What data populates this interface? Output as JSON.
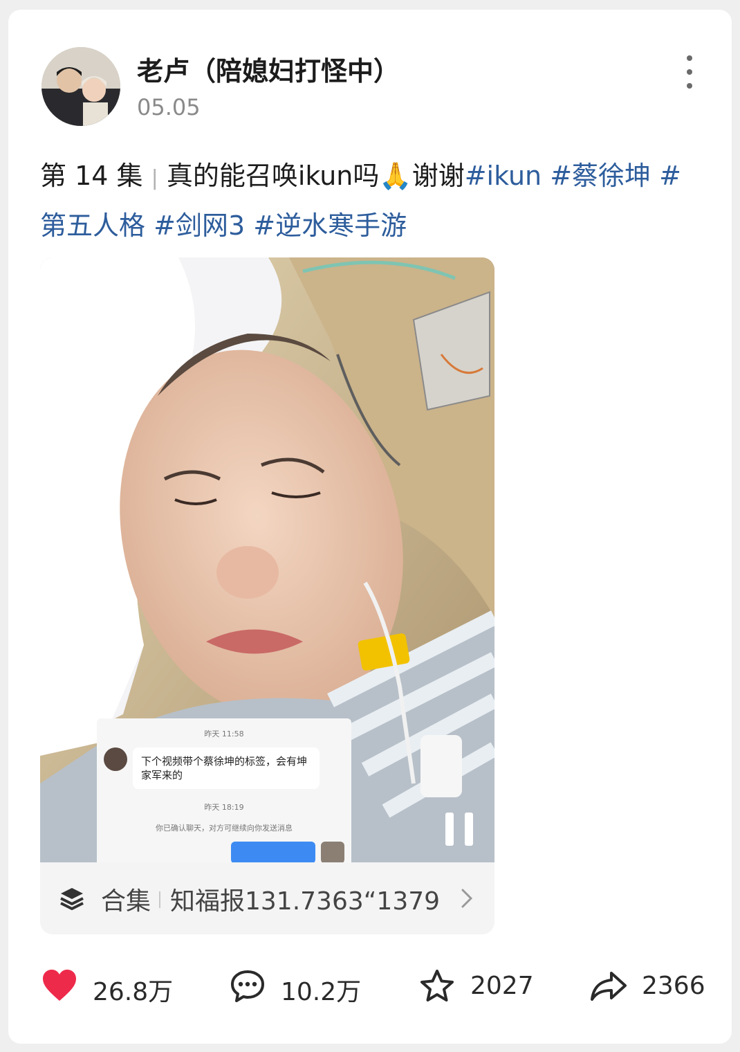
{
  "post": {
    "author": "老卢（陪媳妇打怪中）",
    "date": "05.05",
    "caption": {
      "episode": "第 14 集",
      "separator": "|",
      "text": "真的能召唤ikun吗🙏谢谢",
      "tags": [
        "#ikun",
        "#蔡徐坤",
        "#第五人格",
        "#剑网3",
        "#逆水寒手游"
      ]
    }
  },
  "media": {
    "chat_overlay": {
      "time_1": "昨天 11:58",
      "message": "下个视频带个蔡徐坤的标签，会有坤家军来的",
      "time_2": "昨天 18:19",
      "notice": "你已确认聊天，对方可继续向你发送消息"
    }
  },
  "collection": {
    "label": "合集",
    "title": "知福报131.7363“1379"
  },
  "stats": {
    "likes": "26.8万",
    "comments": "10.2万",
    "favorites": "2027",
    "shares": "2366"
  },
  "colors": {
    "hashtag": "#2d5d9c",
    "like_heart": "#ee2a4b",
    "chat_bubble_blue": "#3d8bf2"
  },
  "icons": [
    "more-icon",
    "pause-icon",
    "layers-icon",
    "chevron-right-icon",
    "heart-icon",
    "comment-icon",
    "star-icon",
    "share-icon"
  ]
}
